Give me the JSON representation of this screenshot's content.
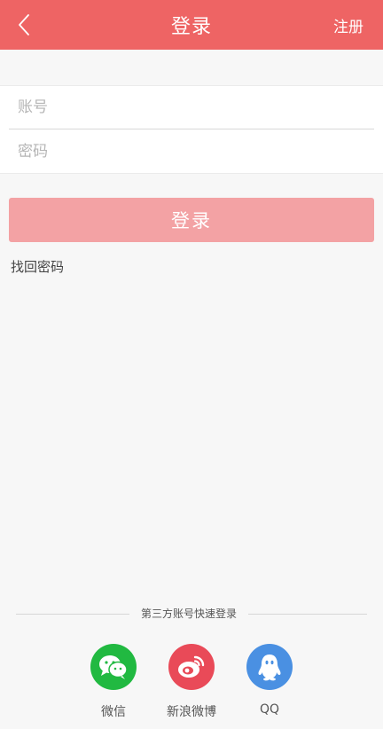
{
  "header": {
    "title": "登录",
    "register_label": "注册",
    "background": "#ee6464"
  },
  "form": {
    "account_placeholder": "账号",
    "password_placeholder": "密码"
  },
  "login_button": {
    "label": "登录",
    "color": "#f3a2a4"
  },
  "forgot_label": "找回密码",
  "third_party": {
    "heading": "第三方账号快速登录",
    "providers": [
      {
        "label": "微信",
        "icon": "wechat-icon",
        "color": "#21b941"
      },
      {
        "label": "新浪微博",
        "icon": "weibo-icon",
        "color": "#e94a58"
      },
      {
        "label": "QQ",
        "icon": "qq-icon",
        "color": "#4a90e2"
      }
    ]
  }
}
